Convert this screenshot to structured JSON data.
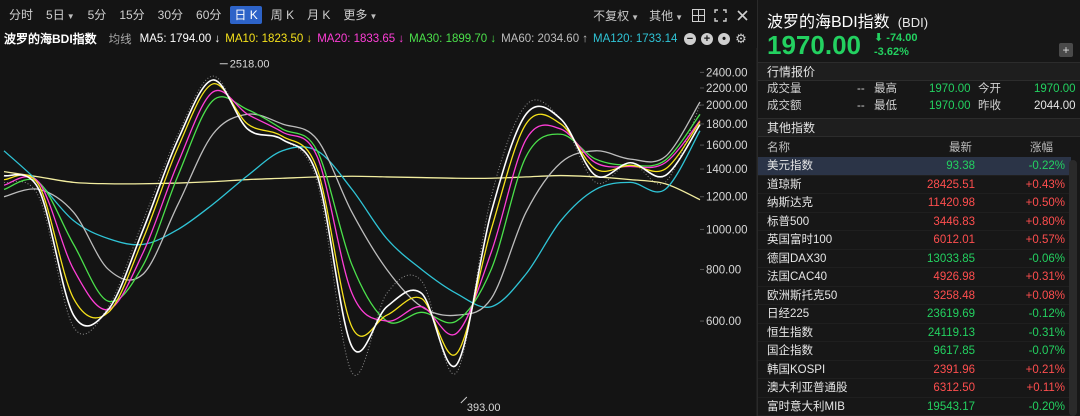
{
  "toolbar": {
    "periods": [
      {
        "label": "分时",
        "arrow": false,
        "active": false
      },
      {
        "label": "5日",
        "arrow": true,
        "active": false
      },
      {
        "label": "5分",
        "arrow": false,
        "active": false
      },
      {
        "label": "15分",
        "arrow": false,
        "active": false
      },
      {
        "label": "30分",
        "arrow": false,
        "active": false
      },
      {
        "label": "60分",
        "arrow": false,
        "active": false
      },
      {
        "label": "日 K",
        "arrow": false,
        "active": true
      },
      {
        "label": "周 K",
        "arrow": false,
        "active": false
      },
      {
        "label": "月 K",
        "arrow": false,
        "active": false
      },
      {
        "label": "更多",
        "arrow": true,
        "active": false
      }
    ],
    "adjust_label": "不复权",
    "other_label": "其他",
    "icons": [
      "grid-layout-icon",
      "expand-icon",
      "close-icon"
    ]
  },
  "legend": {
    "index_name": "波罗的海BDI指数",
    "ma_type": "均线",
    "items": [
      {
        "label": "MA5: 1794.00 ↓",
        "color": "#ffffff"
      },
      {
        "label": "MA10: 1823.50 ↓",
        "color": "#f5e11b"
      },
      {
        "label": "MA20: 1833.65 ↓",
        "color": "#ff3ed7"
      },
      {
        "label": "MA30: 1899.70 ↓",
        "color": "#4be04b"
      },
      {
        "label": "MA60: 2034.60 ↑",
        "color": "#bdbdbd"
      },
      {
        "label": "MA120: 1733.14",
        "color": "#2fc4d6"
      }
    ]
  },
  "quote": {
    "title": "波罗的海BDI指数",
    "code": "(BDI)",
    "price": "1970.00",
    "change": "-74.00",
    "change_pct": "-3.62%",
    "add_label": "+",
    "market_section": "行情报价",
    "stats": {
      "volume_label": "成交量",
      "volume_value": "--",
      "high_label": "最高",
      "high_value": "1970.00",
      "open_label": "今开",
      "open_value": "1970.00",
      "amount_label": "成交额",
      "amount_value": "--",
      "low_label": "最低",
      "low_value": "1970.00",
      "prev_close_label": "昨收",
      "prev_close_value": "2044.00"
    },
    "other_section": "其他指数",
    "table_headers": {
      "name": "名称",
      "latest": "最新",
      "change": "涨幅"
    },
    "indices": [
      {
        "name": "美元指数",
        "price": "93.38",
        "change": "-0.22%",
        "dir": "down",
        "selected": true
      },
      {
        "name": "道琼斯",
        "price": "28425.51",
        "change": "+0.43%",
        "dir": "up",
        "selected": false
      },
      {
        "name": "纳斯达克",
        "price": "11420.98",
        "change": "+0.50%",
        "dir": "up",
        "selected": false
      },
      {
        "name": "标普500",
        "price": "3446.83",
        "change": "+0.80%",
        "dir": "up",
        "selected": false
      },
      {
        "name": "英国富时100",
        "price": "6012.01",
        "change": "+0.57%",
        "dir": "up",
        "selected": false
      },
      {
        "name": "德国DAX30",
        "price": "13033.85",
        "change": "-0.06%",
        "dir": "down",
        "selected": false
      },
      {
        "name": "法国CAC40",
        "price": "4926.98",
        "change": "+0.31%",
        "dir": "up",
        "selected": false
      },
      {
        "name": "欧洲斯托克50",
        "price": "3258.48",
        "change": "+0.08%",
        "dir": "up",
        "selected": false
      },
      {
        "name": "日经225",
        "price": "23619.69",
        "change": "-0.12%",
        "dir": "down",
        "selected": false
      },
      {
        "name": "恒生指数",
        "price": "24119.13",
        "change": "-0.31%",
        "dir": "down",
        "selected": false
      },
      {
        "name": "国企指数",
        "price": "9617.85",
        "change": "-0.07%",
        "dir": "down",
        "selected": false
      },
      {
        "name": "韩国KOSPI",
        "price": "2391.96",
        "change": "+0.21%",
        "dir": "up",
        "selected": false
      },
      {
        "name": "澳大利亚普通股",
        "price": "6312.50",
        "change": "+0.11%",
        "dir": "up",
        "selected": false
      },
      {
        "name": "富时意大利MIB",
        "price": "19543.17",
        "change": "-0.20%",
        "dir": "down",
        "selected": false
      }
    ]
  },
  "chart_data": {
    "type": "line",
    "y_scale": "log",
    "y_ticks": [
      600,
      800,
      1000,
      1200,
      1400,
      1600,
      1800,
      2000,
      2200,
      2400
    ],
    "annotations": [
      {
        "label": "2518.00",
        "x": 62,
        "y": 2518
      },
      {
        "label": "393.00",
        "x": 133,
        "y": 393
      }
    ],
    "x": [
      0,
      10,
      20,
      30,
      40,
      50,
      60,
      70,
      80,
      90,
      100,
      110,
      120,
      130,
      140,
      150,
      160,
      170,
      180,
      190,
      200
    ],
    "close_approx": [
      1300,
      1200,
      580,
      650,
      1050,
      1700,
      2350,
      1750,
      1650,
      1300,
      450,
      700,
      750,
      450,
      1200,
      2000,
      1850,
      1300,
      1450,
      1300,
      2000
    ],
    "series": [
      {
        "name": "MA5",
        "color": "#ffffff",
        "values": [
          1350,
          1250,
          620,
          640,
          1000,
          1650,
          2300,
          1750,
          1650,
          1350,
          520,
          650,
          700,
          470,
          1100,
          1900,
          1850,
          1350,
          1450,
          1350,
          1794
        ]
      },
      {
        "name": "MA10",
        "color": "#f5e11b",
        "values": [
          1320,
          1280,
          680,
          630,
          950,
          1580,
          2250,
          1800,
          1680,
          1400,
          580,
          620,
          680,
          500,
          1000,
          1800,
          1800,
          1400,
          1430,
          1400,
          1823.5
        ]
      },
      {
        "name": "MA20",
        "color": "#ff3ed7",
        "values": [
          1280,
          1300,
          800,
          640,
          880,
          1450,
          2150,
          1900,
          1720,
          1500,
          700,
          600,
          650,
          560,
          880,
          1650,
          1750,
          1450,
          1420,
          1450,
          1833.65
        ]
      },
      {
        "name": "MA30",
        "color": "#4be04b",
        "values": [
          1250,
          1300,
          920,
          670,
          820,
          1350,
          2050,
          1950,
          1750,
          1550,
          820,
          600,
          630,
          600,
          800,
          1500,
          1700,
          1480,
          1430,
          1470,
          1899.7
        ]
      },
      {
        "name": "MA60",
        "color": "#bdbdbd",
        "values": [
          1200,
          1250,
          1100,
          800,
          780,
          1150,
          1700,
          1900,
          1800,
          1650,
          1100,
          800,
          650,
          620,
          680,
          1100,
          1450,
          1550,
          1480,
          1500,
          2034.6
        ]
      },
      {
        "name": "MA120",
        "color": "#2fc4d6",
        "values": [
          1550,
          1300,
          1050,
          950,
          920,
          1000,
          1150,
          1350,
          1550,
          1550,
          1250,
          950,
          800,
          700,
          650,
          780,
          1050,
          1250,
          1300,
          1250,
          1733.14
        ]
      },
      {
        "name": "MA250",
        "color": "#f3eea0",
        "values": [
          1380,
          1340,
          1300,
          1290,
          1290,
          1295,
          1305,
          1320,
          1330,
          1340,
          1345,
          1340,
          1335,
          1330,
          1330,
          1340,
          1350,
          1340,
          1320,
          1290,
          1180
        ]
      }
    ]
  }
}
